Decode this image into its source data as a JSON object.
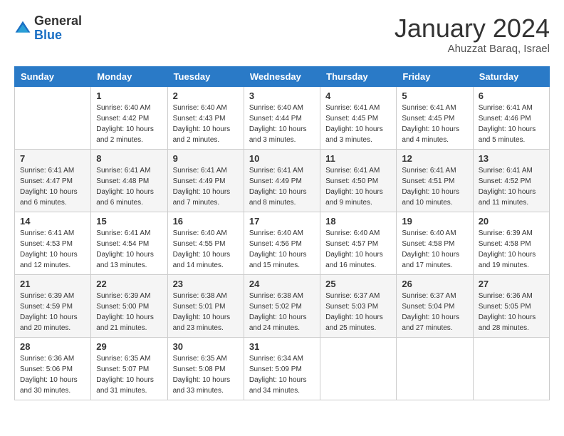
{
  "header": {
    "logo_general": "General",
    "logo_blue": "Blue",
    "month_title": "January 2024",
    "subtitle": "Ahuzzat Baraq, Israel"
  },
  "weekdays": [
    "Sunday",
    "Monday",
    "Tuesday",
    "Wednesday",
    "Thursday",
    "Friday",
    "Saturday"
  ],
  "weeks": [
    [
      {
        "day": "",
        "sunrise": "",
        "sunset": "",
        "daylight": ""
      },
      {
        "day": "1",
        "sunrise": "Sunrise: 6:40 AM",
        "sunset": "Sunset: 4:42 PM",
        "daylight": "Daylight: 10 hours and 2 minutes."
      },
      {
        "day": "2",
        "sunrise": "Sunrise: 6:40 AM",
        "sunset": "Sunset: 4:43 PM",
        "daylight": "Daylight: 10 hours and 2 minutes."
      },
      {
        "day": "3",
        "sunrise": "Sunrise: 6:40 AM",
        "sunset": "Sunset: 4:44 PM",
        "daylight": "Daylight: 10 hours and 3 minutes."
      },
      {
        "day": "4",
        "sunrise": "Sunrise: 6:41 AM",
        "sunset": "Sunset: 4:45 PM",
        "daylight": "Daylight: 10 hours and 3 minutes."
      },
      {
        "day": "5",
        "sunrise": "Sunrise: 6:41 AM",
        "sunset": "Sunset: 4:45 PM",
        "daylight": "Daylight: 10 hours and 4 minutes."
      },
      {
        "day": "6",
        "sunrise": "Sunrise: 6:41 AM",
        "sunset": "Sunset: 4:46 PM",
        "daylight": "Daylight: 10 hours and 5 minutes."
      }
    ],
    [
      {
        "day": "7",
        "sunrise": "Sunrise: 6:41 AM",
        "sunset": "Sunset: 4:47 PM",
        "daylight": "Daylight: 10 hours and 6 minutes."
      },
      {
        "day": "8",
        "sunrise": "Sunrise: 6:41 AM",
        "sunset": "Sunset: 4:48 PM",
        "daylight": "Daylight: 10 hours and 6 minutes."
      },
      {
        "day": "9",
        "sunrise": "Sunrise: 6:41 AM",
        "sunset": "Sunset: 4:49 PM",
        "daylight": "Daylight: 10 hours and 7 minutes."
      },
      {
        "day": "10",
        "sunrise": "Sunrise: 6:41 AM",
        "sunset": "Sunset: 4:49 PM",
        "daylight": "Daylight: 10 hours and 8 minutes."
      },
      {
        "day": "11",
        "sunrise": "Sunrise: 6:41 AM",
        "sunset": "Sunset: 4:50 PM",
        "daylight": "Daylight: 10 hours and 9 minutes."
      },
      {
        "day": "12",
        "sunrise": "Sunrise: 6:41 AM",
        "sunset": "Sunset: 4:51 PM",
        "daylight": "Daylight: 10 hours and 10 minutes."
      },
      {
        "day": "13",
        "sunrise": "Sunrise: 6:41 AM",
        "sunset": "Sunset: 4:52 PM",
        "daylight": "Daylight: 10 hours and 11 minutes."
      }
    ],
    [
      {
        "day": "14",
        "sunrise": "Sunrise: 6:41 AM",
        "sunset": "Sunset: 4:53 PM",
        "daylight": "Daylight: 10 hours and 12 minutes."
      },
      {
        "day": "15",
        "sunrise": "Sunrise: 6:41 AM",
        "sunset": "Sunset: 4:54 PM",
        "daylight": "Daylight: 10 hours and 13 minutes."
      },
      {
        "day": "16",
        "sunrise": "Sunrise: 6:40 AM",
        "sunset": "Sunset: 4:55 PM",
        "daylight": "Daylight: 10 hours and 14 minutes."
      },
      {
        "day": "17",
        "sunrise": "Sunrise: 6:40 AM",
        "sunset": "Sunset: 4:56 PM",
        "daylight": "Daylight: 10 hours and 15 minutes."
      },
      {
        "day": "18",
        "sunrise": "Sunrise: 6:40 AM",
        "sunset": "Sunset: 4:57 PM",
        "daylight": "Daylight: 10 hours and 16 minutes."
      },
      {
        "day": "19",
        "sunrise": "Sunrise: 6:40 AM",
        "sunset": "Sunset: 4:58 PM",
        "daylight": "Daylight: 10 hours and 17 minutes."
      },
      {
        "day": "20",
        "sunrise": "Sunrise: 6:39 AM",
        "sunset": "Sunset: 4:58 PM",
        "daylight": "Daylight: 10 hours and 19 minutes."
      }
    ],
    [
      {
        "day": "21",
        "sunrise": "Sunrise: 6:39 AM",
        "sunset": "Sunset: 4:59 PM",
        "daylight": "Daylight: 10 hours and 20 minutes."
      },
      {
        "day": "22",
        "sunrise": "Sunrise: 6:39 AM",
        "sunset": "Sunset: 5:00 PM",
        "daylight": "Daylight: 10 hours and 21 minutes."
      },
      {
        "day": "23",
        "sunrise": "Sunrise: 6:38 AM",
        "sunset": "Sunset: 5:01 PM",
        "daylight": "Daylight: 10 hours and 23 minutes."
      },
      {
        "day": "24",
        "sunrise": "Sunrise: 6:38 AM",
        "sunset": "Sunset: 5:02 PM",
        "daylight": "Daylight: 10 hours and 24 minutes."
      },
      {
        "day": "25",
        "sunrise": "Sunrise: 6:37 AM",
        "sunset": "Sunset: 5:03 PM",
        "daylight": "Daylight: 10 hours and 25 minutes."
      },
      {
        "day": "26",
        "sunrise": "Sunrise: 6:37 AM",
        "sunset": "Sunset: 5:04 PM",
        "daylight": "Daylight: 10 hours and 27 minutes."
      },
      {
        "day": "27",
        "sunrise": "Sunrise: 6:36 AM",
        "sunset": "Sunset: 5:05 PM",
        "daylight": "Daylight: 10 hours and 28 minutes."
      }
    ],
    [
      {
        "day": "28",
        "sunrise": "Sunrise: 6:36 AM",
        "sunset": "Sunset: 5:06 PM",
        "daylight": "Daylight: 10 hours and 30 minutes."
      },
      {
        "day": "29",
        "sunrise": "Sunrise: 6:35 AM",
        "sunset": "Sunset: 5:07 PM",
        "daylight": "Daylight: 10 hours and 31 minutes."
      },
      {
        "day": "30",
        "sunrise": "Sunrise: 6:35 AM",
        "sunset": "Sunset: 5:08 PM",
        "daylight": "Daylight: 10 hours and 33 minutes."
      },
      {
        "day": "31",
        "sunrise": "Sunrise: 6:34 AM",
        "sunset": "Sunset: 5:09 PM",
        "daylight": "Daylight: 10 hours and 34 minutes."
      },
      {
        "day": "",
        "sunrise": "",
        "sunset": "",
        "daylight": ""
      },
      {
        "day": "",
        "sunrise": "",
        "sunset": "",
        "daylight": ""
      },
      {
        "day": "",
        "sunrise": "",
        "sunset": "",
        "daylight": ""
      }
    ]
  ]
}
